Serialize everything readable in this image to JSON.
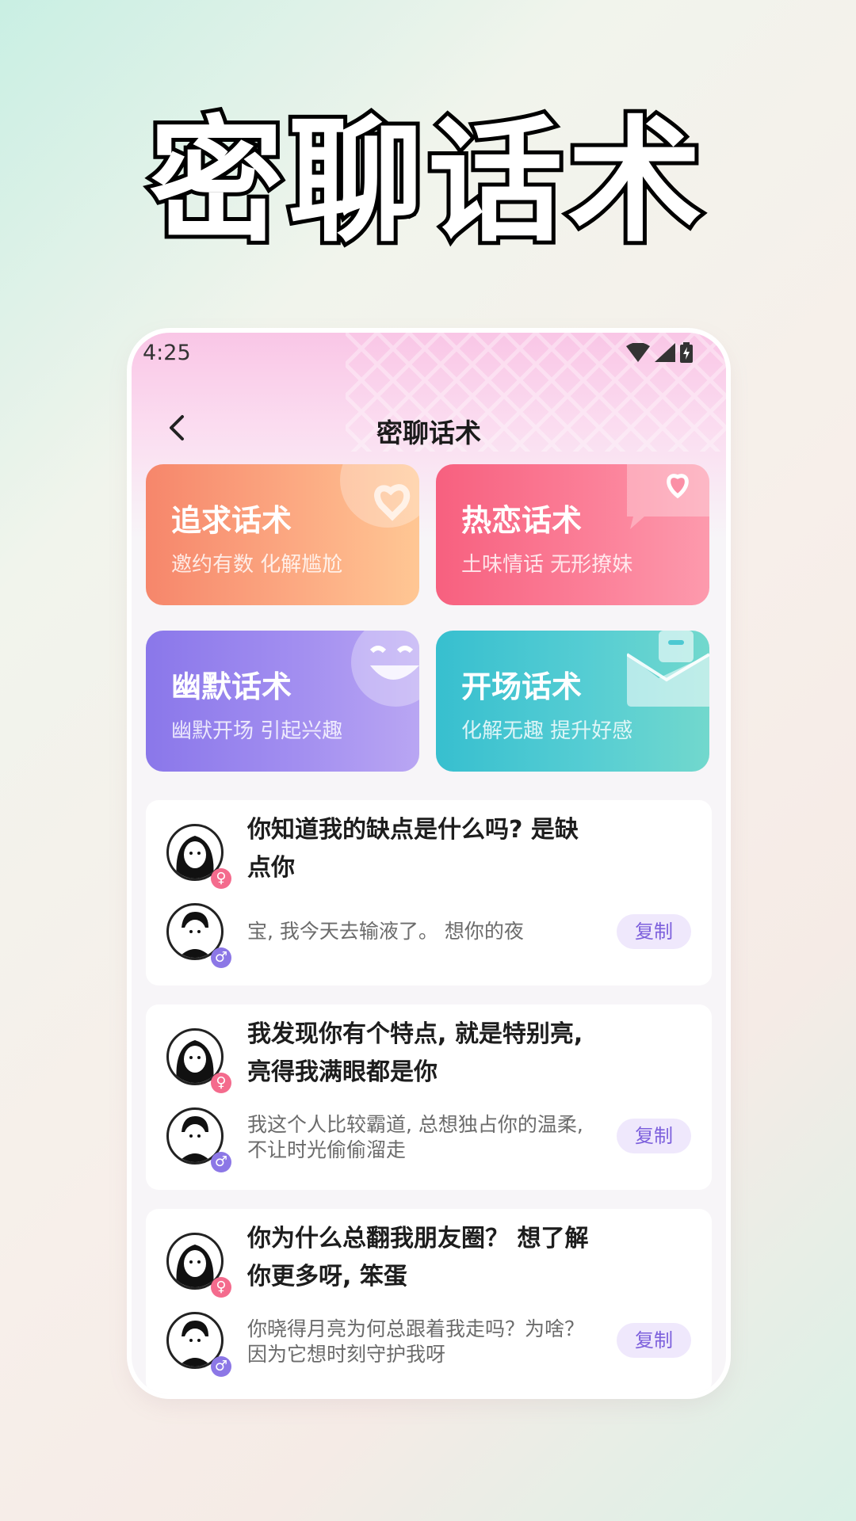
{
  "promo": {
    "title": "密聊话术"
  },
  "status_bar": {
    "time": "4:25"
  },
  "nav": {
    "title": "密聊话术"
  },
  "categories": [
    {
      "title": "追求话术",
      "subtitle": "邀约有数 化解尴尬"
    },
    {
      "title": "热恋话术",
      "subtitle": "土味情话 无形撩妹"
    },
    {
      "title": "幽默话术",
      "subtitle": "幽默开场 引起兴趣"
    },
    {
      "title": "开场话术",
      "subtitle": "化解无趣 提升好感"
    }
  ],
  "chats": [
    {
      "question": "你知道我的缺点是什么吗? 是缺点你",
      "answer": "宝, 我今天去输液了。 想你的夜",
      "copy_label": "复制",
      "female_badge": "♀",
      "male_badge": "♂"
    },
    {
      "question": "我发现你有个特点, 就是特别亮, 亮得我满眼都是你",
      "answer": "我这个人比较霸道, 总想独占你的温柔, 不让时光偷偷溜走",
      "copy_label": "复制",
      "female_badge": "♀",
      "male_badge": "♂"
    },
    {
      "question": "你为什么总翻我朋友圈？ 想了解你更多呀, 笨蛋",
      "answer": "你晓得月亮为何总跟着我走吗？为啥？因为它想时刻守护我呀",
      "copy_label": "复制",
      "female_badge": "♀",
      "male_badge": "♂"
    }
  ],
  "colors": {
    "accent_purple": "#7c5fdc",
    "female": "#f46b8d",
    "male": "#8c77e6"
  }
}
